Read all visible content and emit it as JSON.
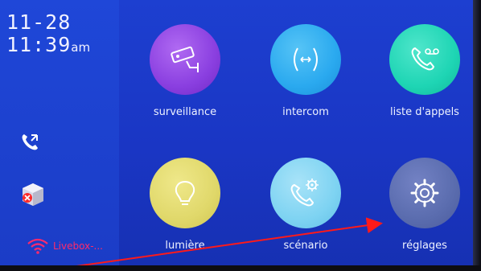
{
  "status": {
    "date": "11-28",
    "time": "11:39",
    "ampm": "am"
  },
  "sidebar": {
    "missed_call_icon": "phone-callback-icon",
    "message_icon": "cube-alert-icon",
    "wifi": {
      "icon": "wifi-icon",
      "network": "Livebox-..."
    }
  },
  "menu": [
    {
      "id": "surveillance",
      "label": "surveillance",
      "icon": "cctv-camera-icon",
      "color": "#8a3fe0"
    },
    {
      "id": "intercom",
      "label": "intercom",
      "icon": "intercom-phone-icon",
      "color": "#2aa9ef"
    },
    {
      "id": "call-list",
      "label": "liste d'appels",
      "icon": "voicemail-phone-icon",
      "color": "#1ed5b4"
    },
    {
      "id": "light",
      "label": "lumière",
      "icon": "bulb-icon",
      "color": "#e0d86a"
    },
    {
      "id": "scenario",
      "label": "scénario",
      "icon": "phone-gear-icon",
      "color": "#7ed3f2"
    },
    {
      "id": "settings",
      "label": "réglages",
      "icon": "gear-icon",
      "color": "#5a6cae"
    }
  ],
  "annotation": {
    "color": "#ff1a1a"
  }
}
